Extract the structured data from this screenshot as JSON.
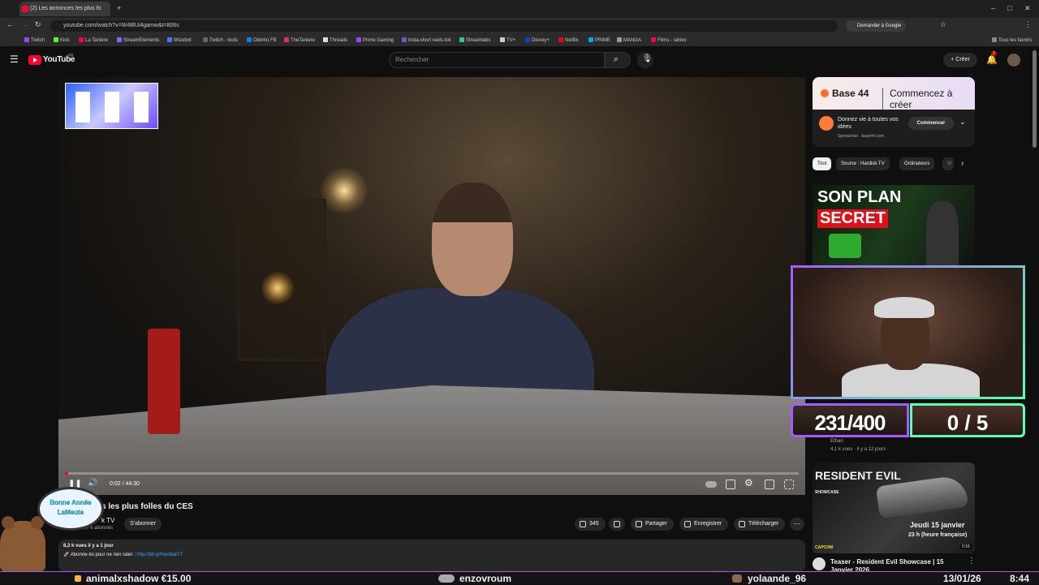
{
  "browser": {
    "tab_title": "(2) Les annonces les plus fo",
    "url": "youtube.com/watch?v=W48lUi4gamw&t=806s",
    "google_button": "Demander à Google",
    "all_bookmarks": "Tous les favoris",
    "bookmarks": [
      "Twitch",
      "Kick",
      "La Tanière",
      "StreamElements",
      "Wizebot",
      "Twitch - tools",
      "Obinho FB",
      "TheTaniere",
      "Threads",
      "Prime Gaming",
      "insta-short reels-tok",
      "Streamlabs",
      "TV+",
      "Disney+",
      "Netflix",
      "PRIME",
      "MANGA",
      "Films - séries"
    ]
  },
  "youtube": {
    "logo_text": "YouTube",
    "country": "FR",
    "search_placeholder": "Rechercher",
    "create_label": "Créer",
    "notifications_count": "2"
  },
  "player": {
    "time": "0:02 / 44:30",
    "progress": 0.001
  },
  "video": {
    "title_partial": "s les plus folles du CES",
    "channel_partial": "k TV",
    "subscribers": "65,7 k abonnés",
    "subscribe_label": "S'abonner",
    "likes": "345",
    "share_label": "Partager",
    "save_label": "Enregistrer",
    "download_label": "Télécharger",
    "views_date": "8,3 k vues  il y a 1 jour",
    "desc_text": "🚀 Abonne-toi pour ne rien rater : ",
    "desc_link": "http://bit.ly/HardiskYT"
  },
  "sidebar": {
    "ad": {
      "brand": "Base 44",
      "tagline": "Commencez à créer",
      "text": "Donnez vie à toutes vos idées",
      "sponsored": "Sponsorisé · base44.com",
      "cta": "Commencer"
    },
    "chips": [
      "Tout",
      "Source : Hardisk TV",
      "Ordinateurs",
      "Vi"
    ],
    "thumb1_line1": "SON PLAN",
    "thumb1_line2": "SECRET",
    "meta_channel": "Ethan",
    "meta_views": "4,1 k vues · il y a 12 jours",
    "thumb2": {
      "brand": "RESIDENT EVIL",
      "sub": "SHOWCASE",
      "date": "Jeudi 15 janvier",
      "hour": "23 h (heure française)",
      "duration": "0:16",
      "publisher": "CAPCOM"
    },
    "video2_title": "Teaser - Resident Evil Showcase | 15 Janvier 2026"
  },
  "stream": {
    "counter_left": "231/400",
    "counter_right": "0 / 5",
    "bubble_line1": "Bonne Année",
    "bubble_line2": "LaMeute",
    "ticker_donation": "animalxshadow €15.00",
    "ticker_follow": "enzovroum",
    "ticker_sub": "yolaande_96",
    "ticker_date": "13/01/26",
    "ticker_time": "8:44"
  },
  "colors": {
    "accent": "#ff0033",
    "overlay_purple": "#a45cff",
    "overlay_green": "#5cffb0",
    "link": "#3ea6ff"
  }
}
